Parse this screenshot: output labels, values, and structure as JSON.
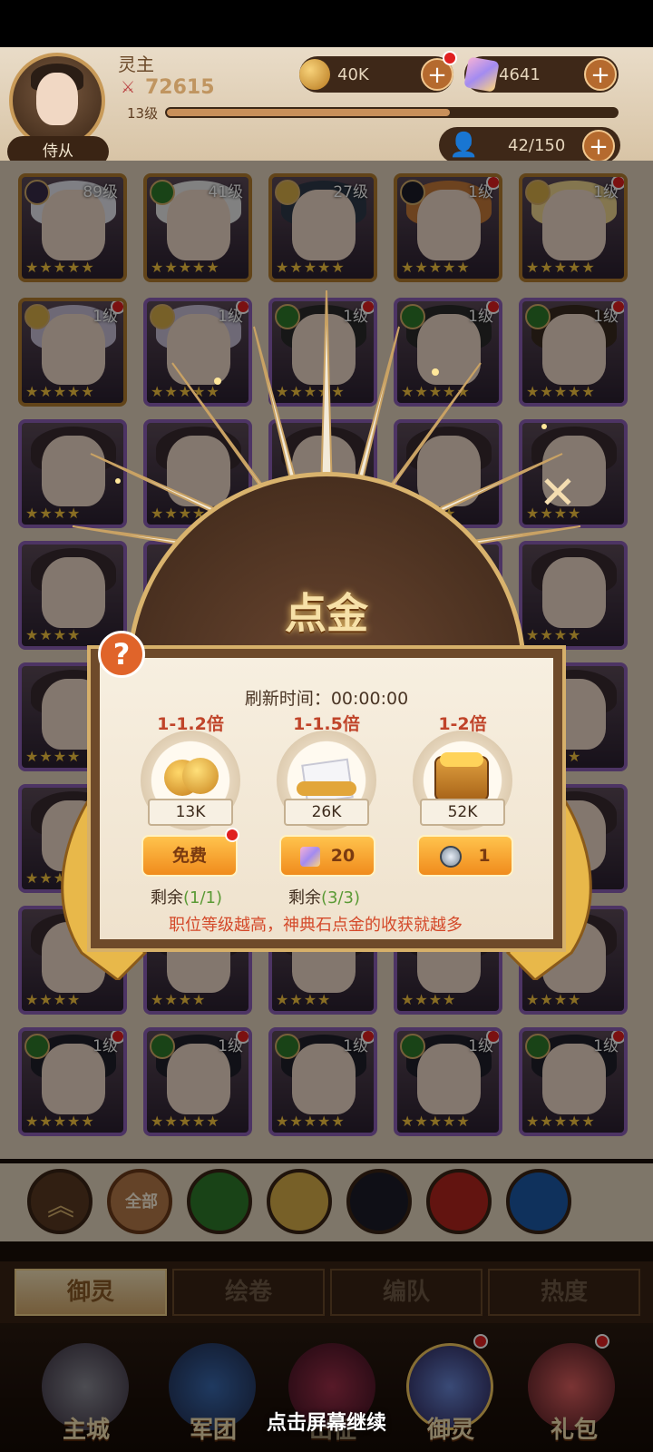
{
  "player": {
    "name": "灵主",
    "power": "72615",
    "level": "13级",
    "attendant_label": "侍从"
  },
  "resources": {
    "gold": "40K",
    "gems": "4641",
    "capacity": "42/150"
  },
  "xp_progress": 0.63,
  "roster": [
    {
      "level": "89级"
    },
    {
      "level": "41级"
    },
    {
      "level": "27级"
    },
    {
      "level": "1级"
    },
    {
      "level": "1级"
    },
    {
      "level": "1级"
    },
    {
      "level": "1级"
    },
    {
      "level": "1级"
    },
    {
      "level": "1级"
    },
    {
      "level": "1级"
    }
  ],
  "roster_bottom": [
    {
      "level": "1级"
    },
    {
      "level": "1级"
    },
    {
      "level": "1级"
    },
    {
      "level": "1级"
    },
    {
      "level": "1级"
    }
  ],
  "popup": {
    "title": "点金",
    "help": "?",
    "refresh_label": "刷新时间：00:00:00",
    "options": [
      {
        "multiplier": "1-1.2倍",
        "amount": "13K",
        "button": "免费",
        "remaining_label": "剩余",
        "remaining": "(1/1)",
        "icon": "gold-coins-icon"
      },
      {
        "multiplier": "1-1.5倍",
        "amount": "26K",
        "button": "20",
        "remaining_label": "剩余",
        "remaining": "(3/3)",
        "icon": "gold-box-icon"
      },
      {
        "multiplier": "1-2倍",
        "amount": "52K",
        "button": "1",
        "icon": "treasure-chest-icon"
      }
    ],
    "hint": "职位等级越高，神典石点金的收获就越多"
  },
  "filters": [
    {
      "label": ""
    },
    {
      "label": "全部"
    },
    {
      "label": ""
    },
    {
      "label": ""
    },
    {
      "label": ""
    },
    {
      "label": ""
    },
    {
      "label": ""
    }
  ],
  "tabs": [
    "御灵",
    "绘卷",
    "编队",
    "热度"
  ],
  "nav": [
    "主城",
    "军团",
    "出征",
    "御灵",
    "礼包"
  ],
  "tap_to_continue": "点击屏幕继续",
  "colors": {
    "accent": "#f08b1c",
    "warning": "#d4492a",
    "remaining_green": "#5a9a35"
  }
}
